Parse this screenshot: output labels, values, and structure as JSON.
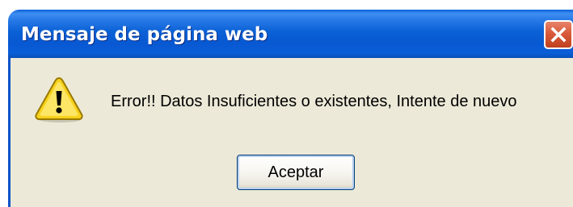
{
  "dialog": {
    "title": "Mensaje de página web",
    "message": "Error!! Datos Insuficientes o existentes, Intente de nuevo",
    "ok_label": "Aceptar",
    "icon": "warning-icon",
    "close_icon": "close-icon"
  },
  "colors": {
    "titlebar": "#0a5fd9",
    "close_button": "#d95a3b",
    "body": "#ece9d8",
    "warning_yellow": "#f7d21c"
  }
}
